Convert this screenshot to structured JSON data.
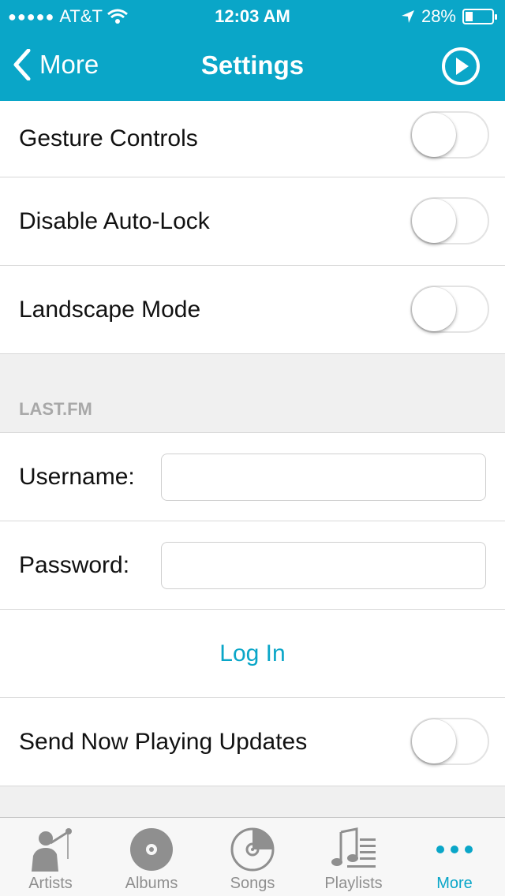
{
  "status_bar": {
    "signal": "●●●●●",
    "carrier": "AT&T",
    "time": "12:03 AM",
    "battery": "28%",
    "battery_level": 0.28
  },
  "nav": {
    "back_label": "More",
    "title": "Settings"
  },
  "toggles": [
    {
      "label": "Gesture Controls",
      "on": false
    },
    {
      "label": "Disable Auto-Lock",
      "on": false
    },
    {
      "label": "Landscape Mode",
      "on": false
    }
  ],
  "lastfm": {
    "header": "LAST.FM",
    "username_label": "Username:",
    "username_value": "",
    "password_label": "Password:",
    "password_value": "",
    "login_label": "Log In",
    "now_playing_label": "Send Now Playing Updates",
    "now_playing_on": false
  },
  "tabs": [
    {
      "label": "Artists",
      "icon": "artist-icon",
      "active": false
    },
    {
      "label": "Albums",
      "icon": "album-icon",
      "active": false
    },
    {
      "label": "Songs",
      "icon": "song-icon",
      "active": false
    },
    {
      "label": "Playlists",
      "icon": "playlist-icon",
      "active": false
    },
    {
      "label": "More",
      "icon": "more-dots-icon",
      "active": true
    }
  ],
  "colors": {
    "accent": "#0aa6c8",
    "tab_inactive": "#8f8f8f"
  }
}
